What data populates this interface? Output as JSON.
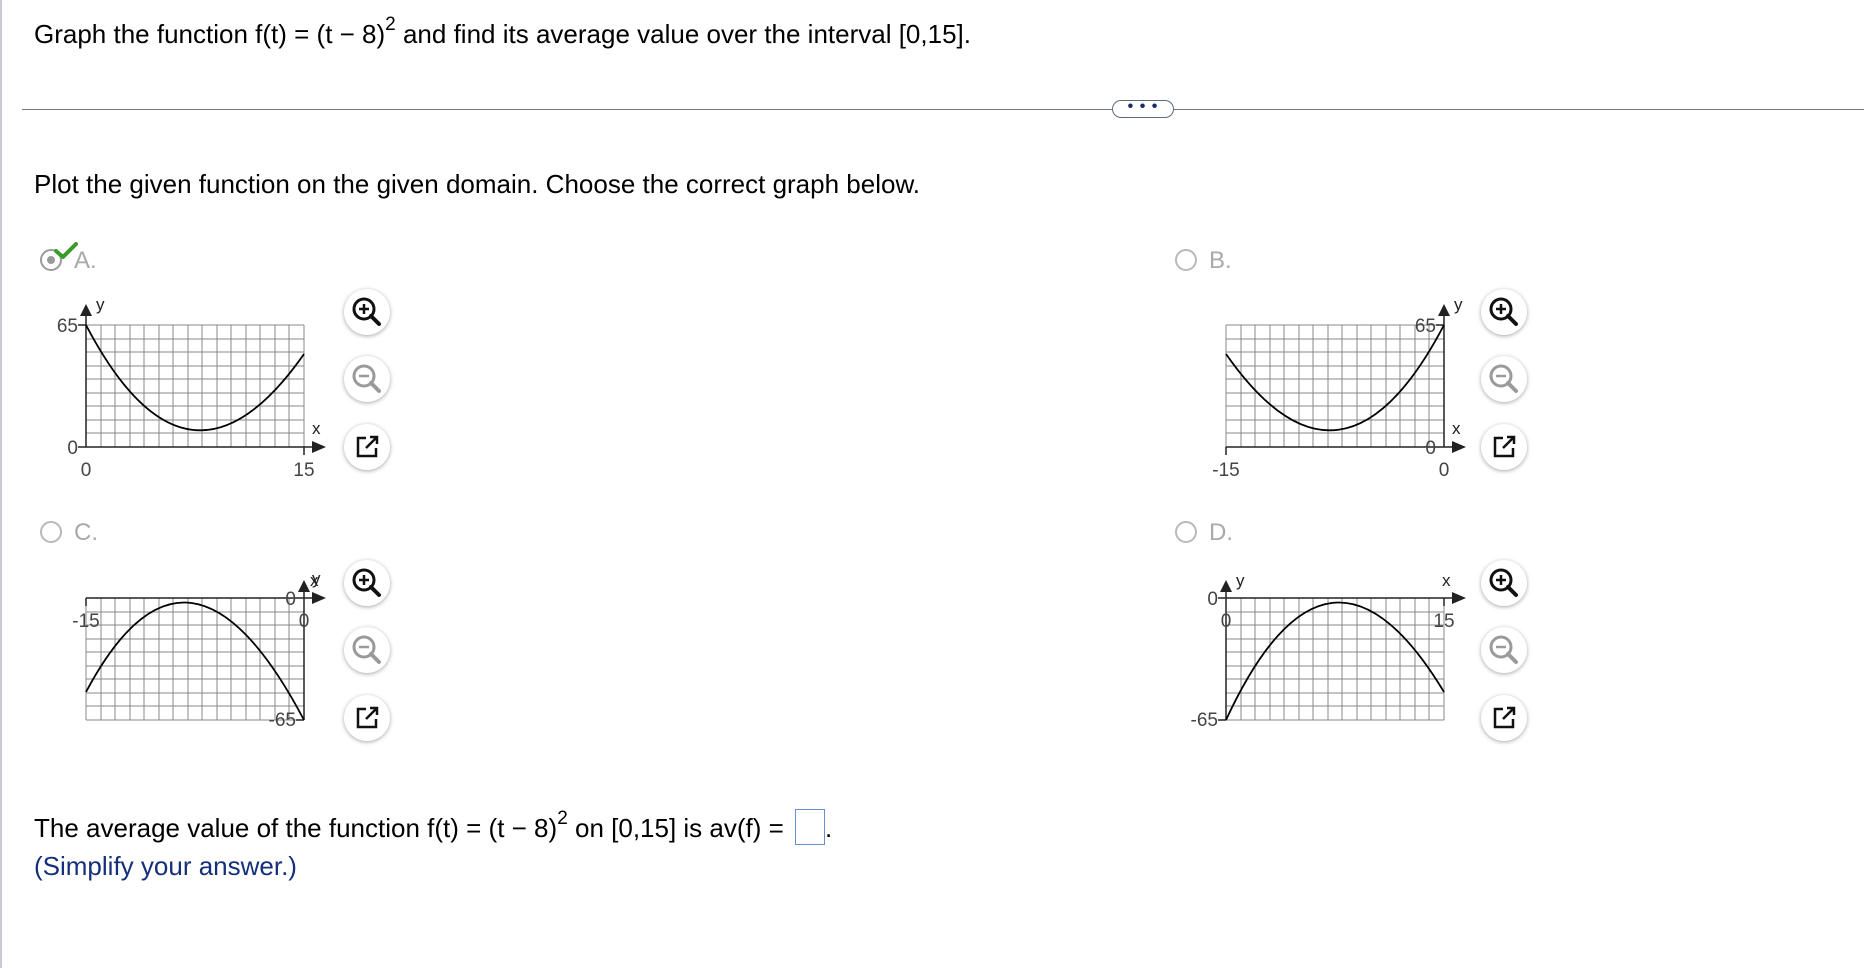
{
  "question": {
    "prefix": "Graph the function f(t) = (t − 8)",
    "exponent": "2",
    "suffix": " and find its average value over the interval [0,15]."
  },
  "more_button_label": "• • •",
  "instruction": "Plot the given function on the given domain. Choose the correct graph below.",
  "choices": [
    {
      "label": "A.",
      "selected": true,
      "correct_mark": true,
      "graph": {
        "x_axis_name": "x",
        "y_axis_name": "y",
        "x_tick_left": "0",
        "x_tick_right": "15",
        "y_tick_top": "65",
        "y_tick_origin": "0"
      }
    },
    {
      "label": "B.",
      "selected": false,
      "graph": {
        "x_axis_name": "x",
        "y_axis_name": "y",
        "x_tick_left": "-15",
        "x_tick_right": "0",
        "y_tick_top": "65",
        "y_tick_origin": "0"
      }
    },
    {
      "label": "C.",
      "selected": false,
      "graph": {
        "x_axis_name": "x",
        "y_axis_name": "y",
        "x_tick_left": "-15",
        "x_tick_right": "0",
        "y_tick_bottom": "-65",
        "y_tick_origin": "0"
      }
    },
    {
      "label": "D.",
      "selected": false,
      "graph": {
        "x_axis_name": "x",
        "y_axis_name": "y",
        "x_tick_left": "0",
        "x_tick_right": "15",
        "y_tick_bottom": "-65",
        "y_tick_origin": "0"
      }
    }
  ],
  "tools": [
    "zoom-in-icon",
    "zoom-out-icon",
    "open-new-window-icon"
  ],
  "answer": {
    "prefix": "The average value of the function f(t) = (t − 8)",
    "exponent": "2",
    "middle": " on [0,15] is av(f) = ",
    "value": "",
    "end": ".",
    "hint": "(Simplify your answer.)"
  },
  "colors": {
    "check": "#3a9a2a",
    "hint_text": "#15307a",
    "input_border": "#6a8fd0"
  }
}
